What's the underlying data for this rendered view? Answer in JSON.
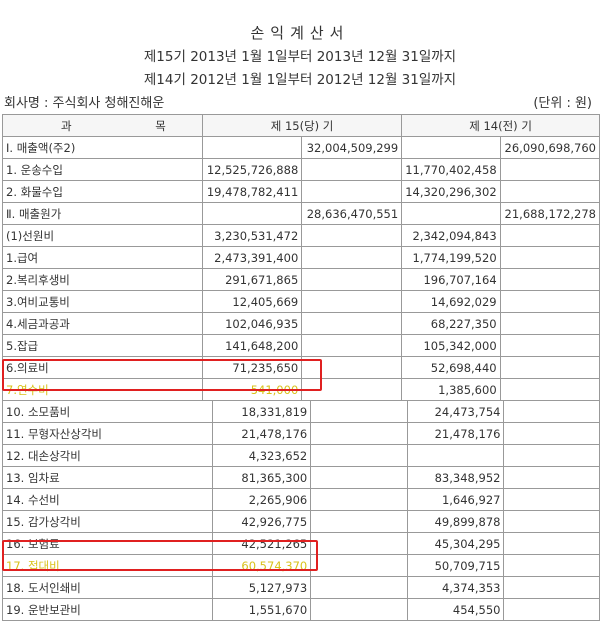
{
  "title": "손익계산서",
  "period_current": "제15기 2013년 1월 1일부터 2013년 12월 31일까지",
  "period_prior": "제14기 2012년 1월 1일부터 2012년 12월 31일까지",
  "company": "회사명 : 주식회사 청해진해운",
  "unit": "(단위 : 원)",
  "header": {
    "item_a": "과",
    "item_b": "목",
    "current": "제 15(당) 기",
    "prior": "제 14(전) 기"
  },
  "rows_top": [
    {
      "label": "Ⅰ. 매출액(주2)",
      "c1": "",
      "c2": "32,004,509,299",
      "p1": "",
      "p2": "26,090,698,760"
    },
    {
      "label": "1. 운송수입",
      "c1": "12,525,726,888",
      "c2": "",
      "p1": "11,770,402,458",
      "p2": ""
    },
    {
      "label": "2. 화물수입",
      "c1": "19,478,782,411",
      "c2": "",
      "p1": "14,320,296,302",
      "p2": ""
    },
    {
      "label": "Ⅱ. 매출원가",
      "c1": "",
      "c2": "28,636,470,551",
      "p1": "",
      "p2": "21,688,172,278"
    },
    {
      "label": "(1)선원비",
      "c1": "3,230,531,472",
      "c2": "",
      "p1": "2,342,094,843",
      "p2": ""
    },
    {
      "label": "1.급여",
      "c1": "2,473,391,400",
      "c2": "",
      "p1": "1,774,199,520",
      "p2": ""
    },
    {
      "label": "2.복리후생비",
      "c1": "291,671,865",
      "c2": "",
      "p1": "196,707,164",
      "p2": ""
    },
    {
      "label": "3.여비교통비",
      "c1": "12,405,669",
      "c2": "",
      "p1": "14,692,029",
      "p2": ""
    },
    {
      "label": "4.세금과공과",
      "c1": "102,046,935",
      "c2": "",
      "p1": "68,227,350",
      "p2": ""
    },
    {
      "label": "5.잡급",
      "c1": "141,648,200",
      "c2": "",
      "p1": "105,342,000",
      "p2": ""
    },
    {
      "label": "6.의료비",
      "c1": "71,235,650",
      "c2": "",
      "p1": "52,698,440",
      "p2": ""
    },
    {
      "label": "7.연수비",
      "c1": "541,000",
      "c2": "",
      "p1": "1,385,600",
      "p2": ""
    }
  ],
  "rows_bottom": [
    {
      "label": "10. 소모품비",
      "c1": "18,331,819",
      "c2": "",
      "p1": "24,473,754",
      "p2": ""
    },
    {
      "label": "11. 무형자산상각비",
      "c1": "21,478,176",
      "c2": "",
      "p1": "21,478,176",
      "p2": ""
    },
    {
      "label": "12. 대손상각비",
      "c1": "4,323,652",
      "c2": "",
      "p1": "",
      "p2": ""
    },
    {
      "label": "13. 임차료",
      "c1": "81,365,300",
      "c2": "",
      "p1": "83,348,952",
      "p2": ""
    },
    {
      "label": "14. 수선비",
      "c1": "2,265,906",
      "c2": "",
      "p1": "1,646,927",
      "p2": ""
    },
    {
      "label": "15. 감가상각비",
      "c1": "42,926,775",
      "c2": "",
      "p1": "49,899,878",
      "p2": ""
    },
    {
      "label": "16. 보험료",
      "c1": "42,521,265",
      "c2": "",
      "p1": "45,304,295",
      "p2": ""
    },
    {
      "label": "17. 접대비",
      "c1": "60,574,370",
      "c2": "",
      "p1": "50,709,715",
      "p2": ""
    },
    {
      "label": "18. 도서인쇄비",
      "c1": "5,127,973",
      "c2": "",
      "p1": "4,374,353",
      "p2": ""
    },
    {
      "label": "19. 운반보관비",
      "c1": "1,551,670",
      "c2": "",
      "p1": "454,550",
      "p2": ""
    }
  ],
  "highlight_color": "#e02020",
  "highlighted_text_color": "#d9c21a"
}
